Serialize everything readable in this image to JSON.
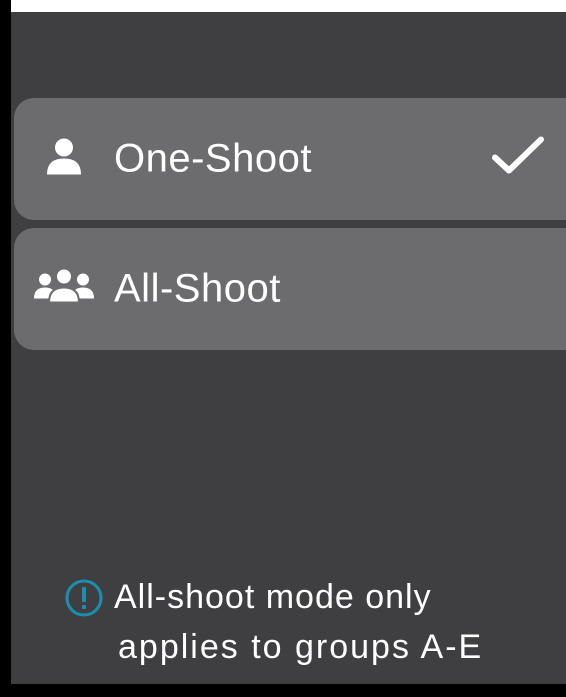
{
  "options": [
    {
      "label": "One-Shoot",
      "icon": "person-icon",
      "selected": true
    },
    {
      "label": "All-Shoot",
      "icon": "group-icon",
      "selected": false
    }
  ],
  "note": {
    "icon": "info-icon",
    "line1": "All-shoot mode only",
    "line2": "applies to groups A-E"
  },
  "colors": {
    "background": "#3f3f41",
    "option": "#6c6c6f",
    "accent": "#1b8fb0",
    "text": "#ffffff"
  }
}
